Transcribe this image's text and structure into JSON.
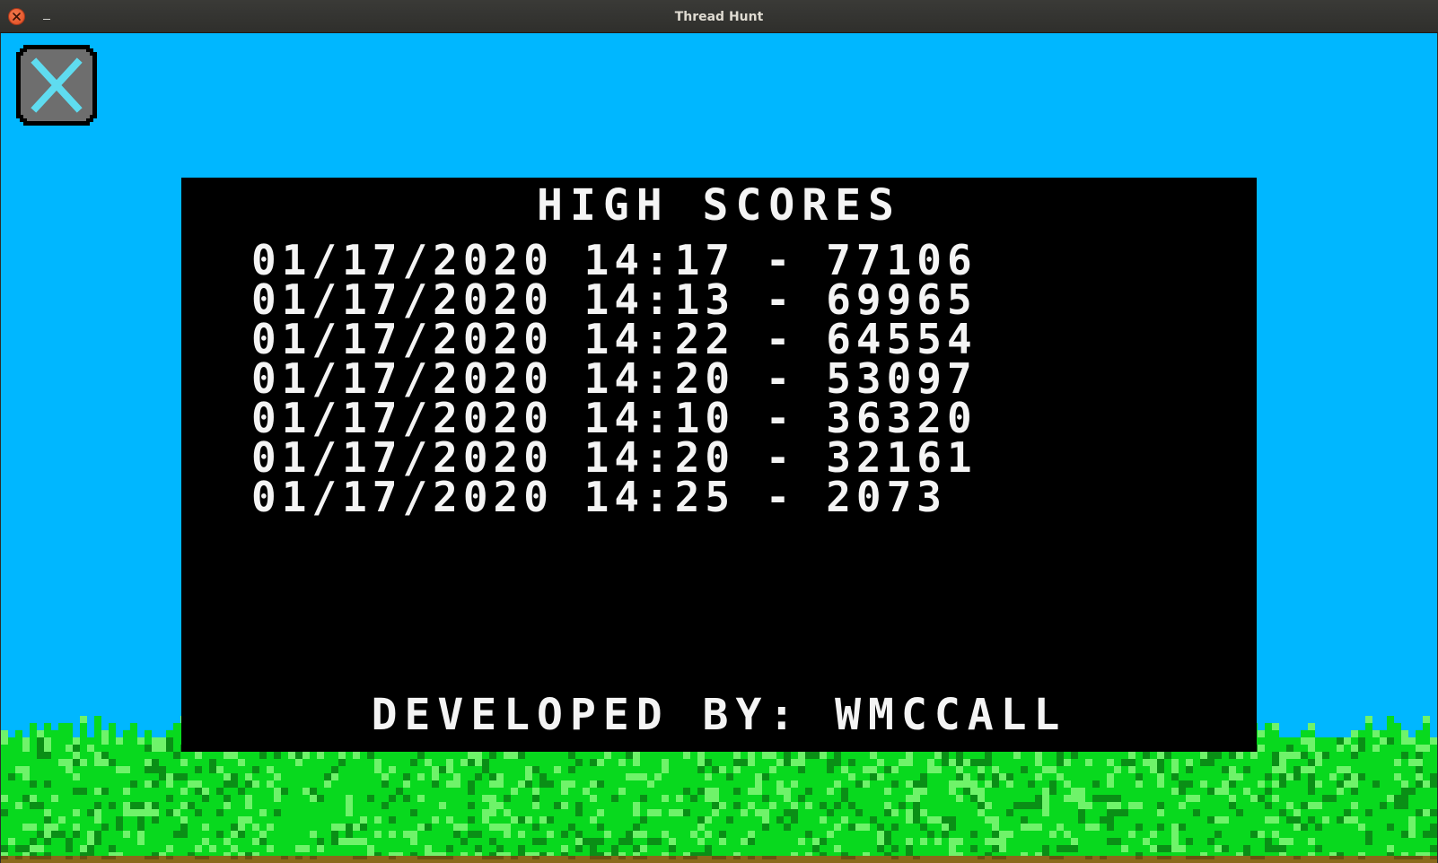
{
  "window": {
    "title": "Thread Hunt"
  },
  "icons": {
    "window_close": "close-icon",
    "window_minimize": "minimize-icon",
    "game_close": "x-close-icon"
  },
  "colors": {
    "sky": "#00b7ff",
    "panel": "#000000",
    "text": "#f4f4f4",
    "grass_light": "#6ff36a",
    "grass_mid": "#08d91e",
    "grass_dark": "#0a8f16",
    "dirt": "#8a6a1c",
    "close_button_fill": "#6e6e6e",
    "close_button_x": "#5fdcf0"
  },
  "high_scores": {
    "title": "HIGH SCORES",
    "entries": [
      "01/17/2020 14:17 - 77106",
      "01/17/2020 14:13 - 69965",
      "01/17/2020 14:22 - 64554",
      "01/17/2020 14:20 - 53097",
      "01/17/2020 14:10 - 36320",
      "01/17/2020 14:20 - 32161",
      "01/17/2020 14:25 - 2073"
    ]
  },
  "footer": {
    "developer_credit": "DEVELOPED BY: WMCCALL"
  }
}
